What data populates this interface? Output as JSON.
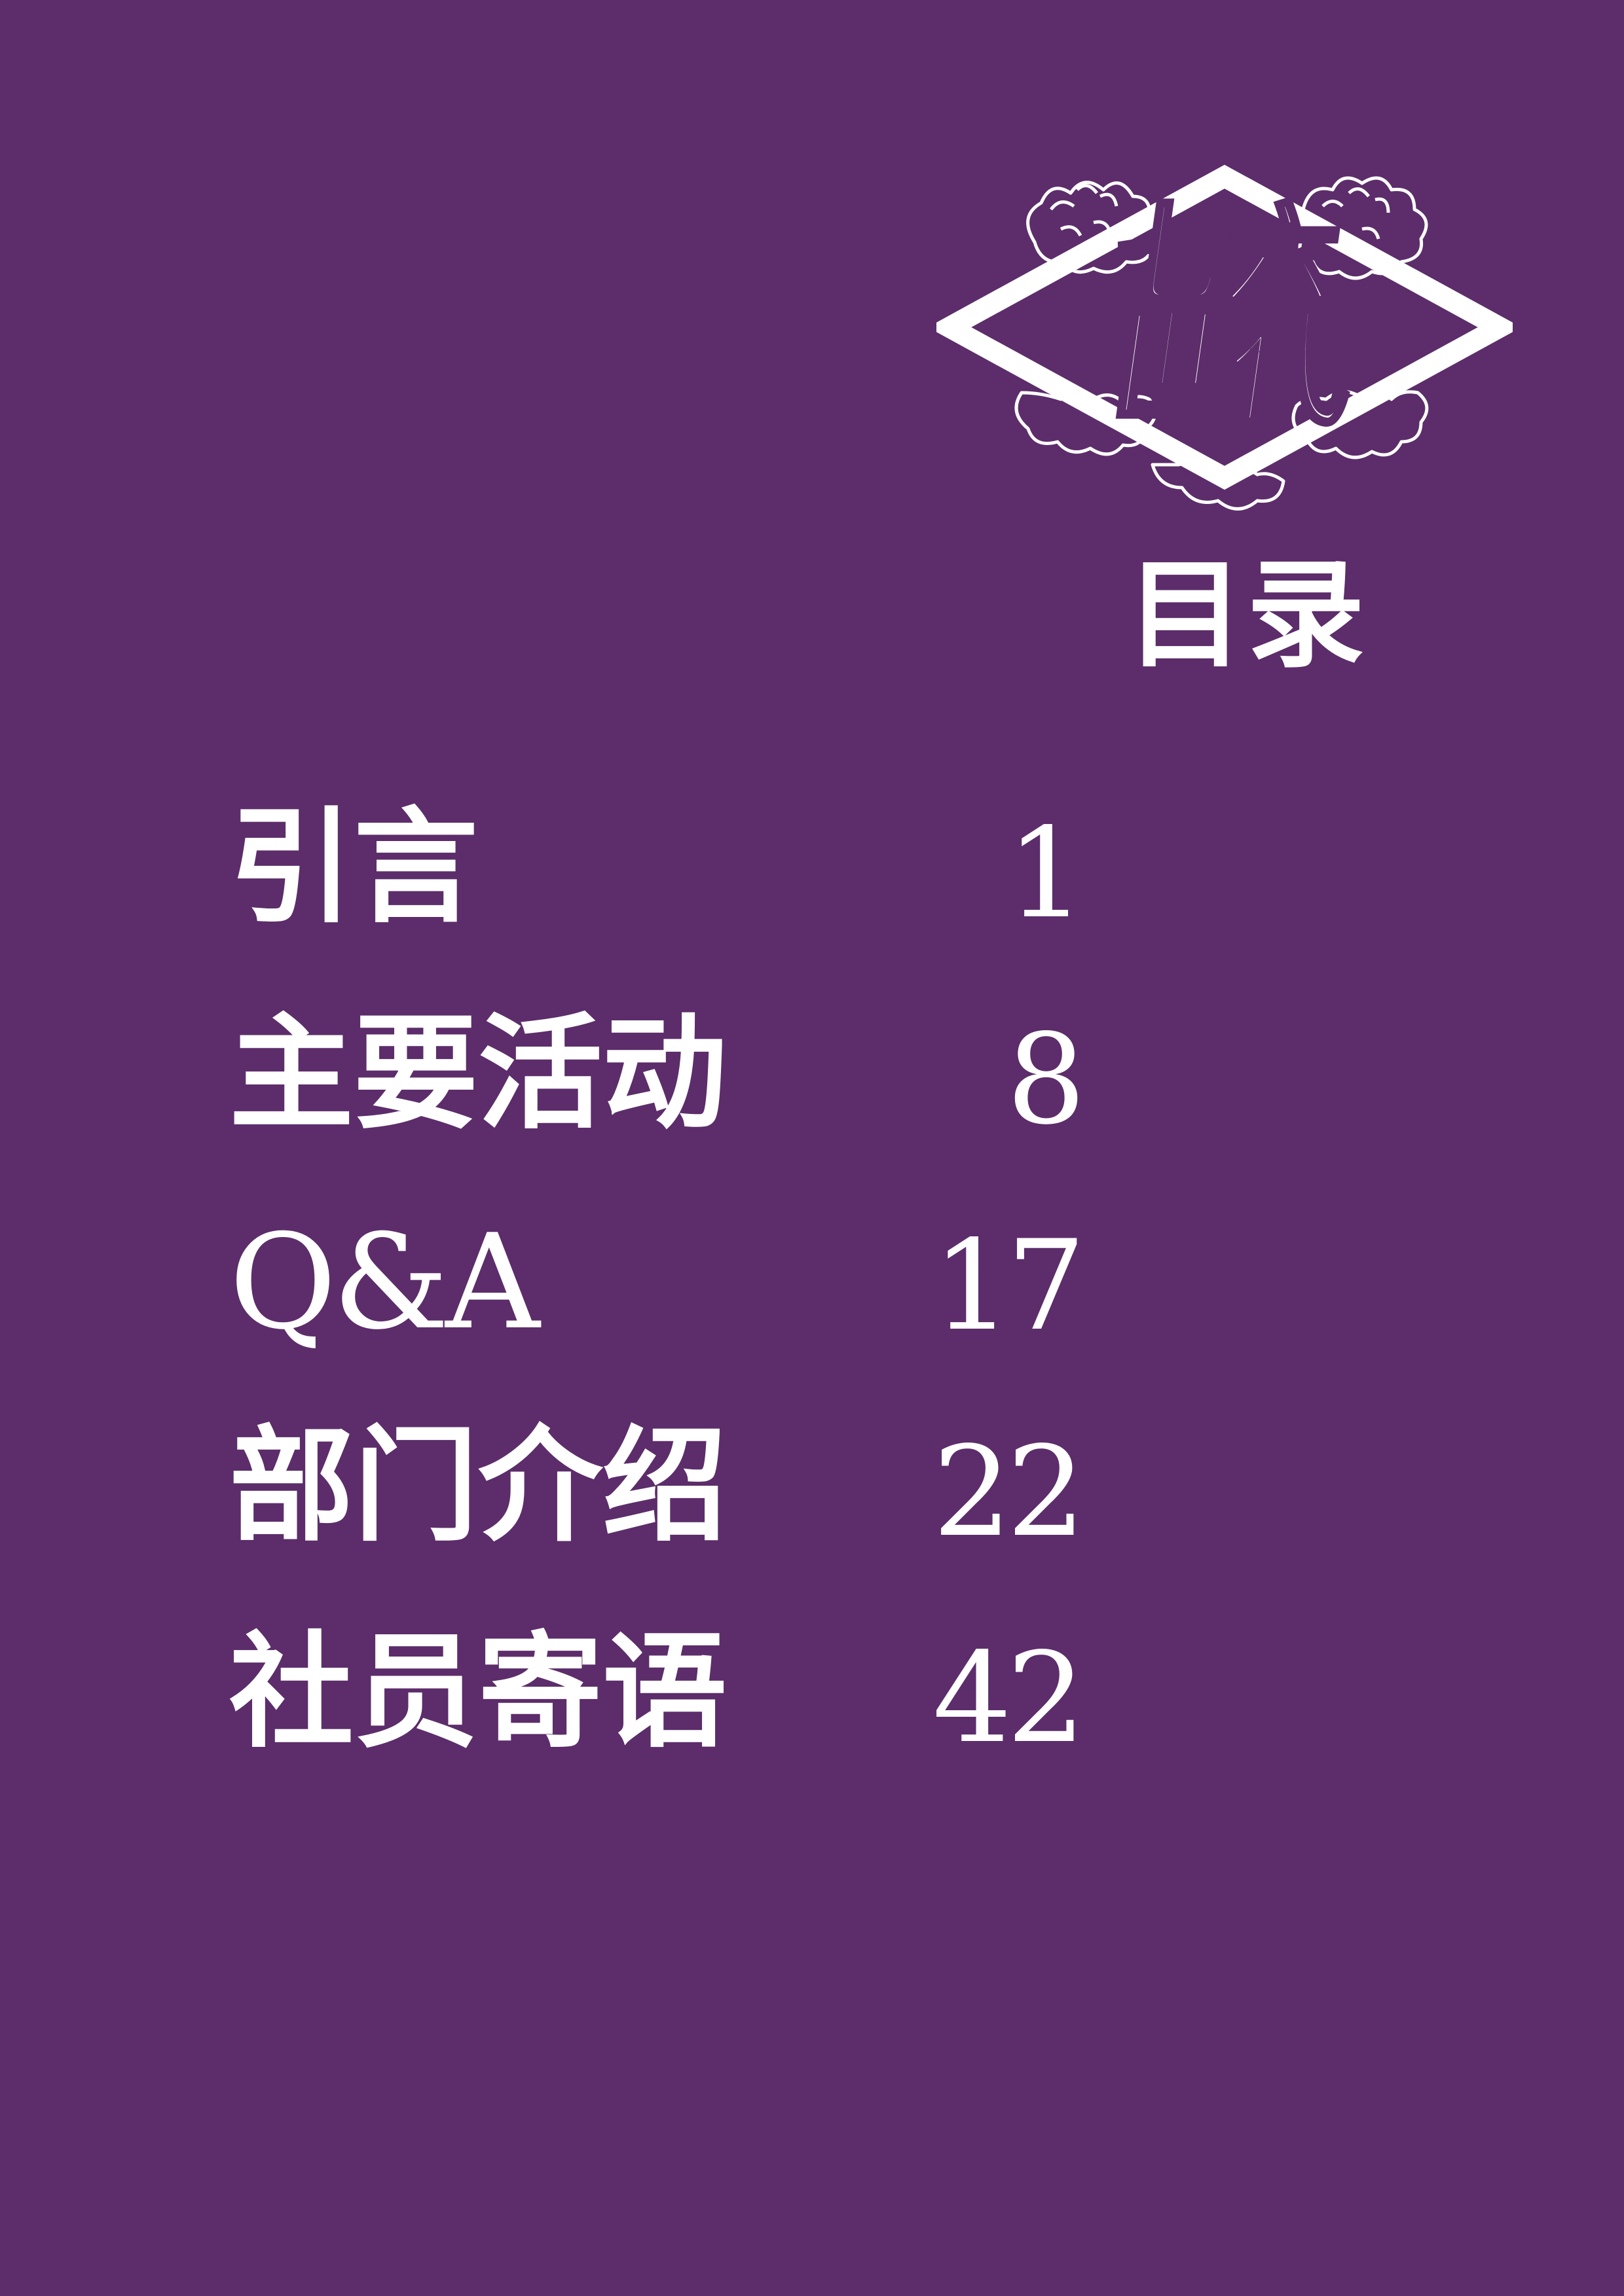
{
  "logo": {
    "icon": "club-emblem-icon",
    "text": "七六世代"
  },
  "toc": {
    "title": "目录",
    "entries": [
      {
        "label": "引言",
        "page": "1"
      },
      {
        "label": "主要活动",
        "page": "8"
      },
      {
        "label": "Q&A",
        "page": "17"
      },
      {
        "label": "部门介绍",
        "page": "22"
      },
      {
        "label": "社员寄语",
        "page": "42"
      }
    ]
  },
  "colors": {
    "background": "#5c2d6a",
    "text": "#ffffff"
  }
}
